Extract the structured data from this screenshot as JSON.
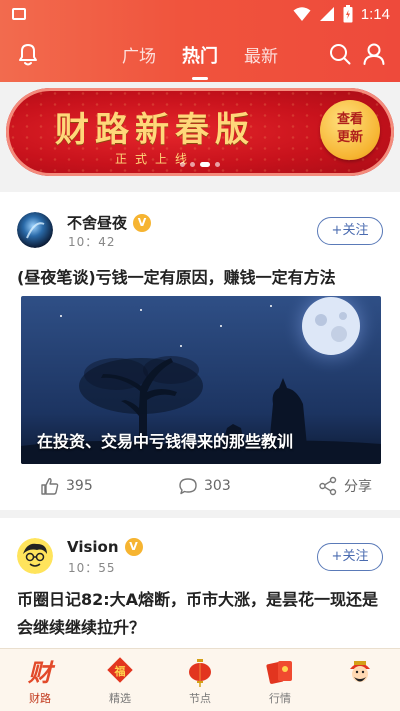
{
  "status_bar": {
    "time": "1:14"
  },
  "nav": {
    "tabs": [
      {
        "label": "广场",
        "active": false
      },
      {
        "label": "热门",
        "active": true
      },
      {
        "label": "最新",
        "active": false
      }
    ],
    "left_icon": "bell-icon",
    "right_icons": [
      "search-icon",
      "user-icon"
    ]
  },
  "banner": {
    "title": "财路新春版",
    "subtitle": "正式上线",
    "button_line1": "查看",
    "button_line2": "更新"
  },
  "posts": [
    {
      "author": "不舍昼夜",
      "verified_badge": "V",
      "time": "10：42",
      "follow_label": "+关注",
      "title": "(昼夜笔谈)亏钱一定有原因，赚钱一定有方法",
      "image_caption": "在投资、交易中亏钱得来的那些教训",
      "likes": "395",
      "comments": "303",
      "share_label": "分享"
    },
    {
      "author": "Vision",
      "verified_badge": "V",
      "time": "10：55",
      "follow_label": "+关注",
      "title": "币圈日记82:大A熔断，币市大涨，是昙花一现还是会继续继续拉升？"
    }
  ],
  "bottom_nav": [
    {
      "label": "财路",
      "icon": "cai-icon",
      "active": true
    },
    {
      "label": "精选",
      "icon": "fu-icon",
      "active": false
    },
    {
      "label": "节点",
      "icon": "lantern-icon",
      "active": false
    },
    {
      "label": "行情",
      "icon": "red-envelope-icon",
      "active": false
    },
    {
      "label": "",
      "icon": "fortune-god-icon",
      "active": false
    }
  ],
  "colors": {
    "header_red": "#f0543d",
    "accent_blue": "#4a6bb0",
    "gold": "#f6b431"
  }
}
